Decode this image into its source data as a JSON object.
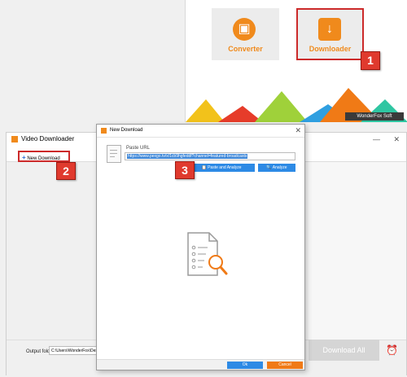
{
  "launcher": {
    "converter_label": "Converter",
    "downloader_label": "Downloader",
    "brand": "WonderFox Soft"
  },
  "badges": {
    "one": "1",
    "two": "2",
    "three": "3"
  },
  "video_downloader": {
    "title": "Video Downloader",
    "new_download_label": "New Download",
    "output_folder_label": "Output folder:",
    "output_folder_value": "C:\\Users\\WonderFox\\Deskto",
    "download_all_label": "Download All"
  },
  "new_download_dialog": {
    "title": "New Download",
    "paste_url_label": "Paste URL",
    "url_value": "https://www.pexgo.tv/x/1cb9hgfeddf?channel=featured-broadcasts",
    "paste_analyze_label": "Paste and Analyze",
    "analyze_label": "Analyze",
    "ok_label": "Ok",
    "cancel_label": "Cancel"
  },
  "colors": {
    "accent_orange": "#f08a1c",
    "accent_blue": "#2d8ae5",
    "highlight_red": "#cc2a2a"
  }
}
